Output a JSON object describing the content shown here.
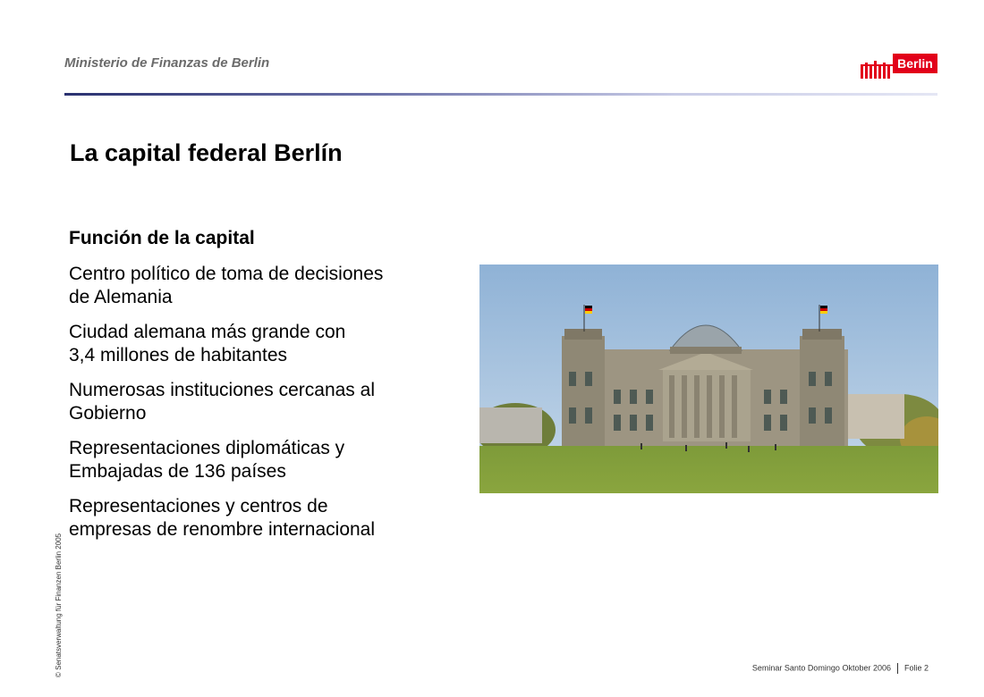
{
  "header": {
    "ministry": "Ministerio de Finanzas de Berlin",
    "logo_text": "Berlin",
    "logo_color": "#e2001a"
  },
  "slide": {
    "title": "La capital federal Berlín",
    "subheading": "Función de la capital",
    "bullets": [
      {
        "line1": "Centro político de toma de decisiones",
        "line2": "de Alemania"
      },
      {
        "line1": "Ciudad alemana más grande con",
        "line2": "3,4 millones de habitantes"
      },
      {
        "line1": "Numerosas instituciones cercanas al",
        "line2": "Gobierno"
      },
      {
        "line1": "Representaciones diplomáticas y",
        "line2": "Embajadas de 136 países"
      },
      {
        "line1": "Representaciones y centros de",
        "line2": "empresas de renombre internacional"
      }
    ]
  },
  "side_copyright": "© Senatsverwaltung für Finanzen  Berlin 2005",
  "footer": {
    "seminar": "Seminar Santo Domingo Oktober 2006",
    "slide_number": "Folie 2"
  }
}
